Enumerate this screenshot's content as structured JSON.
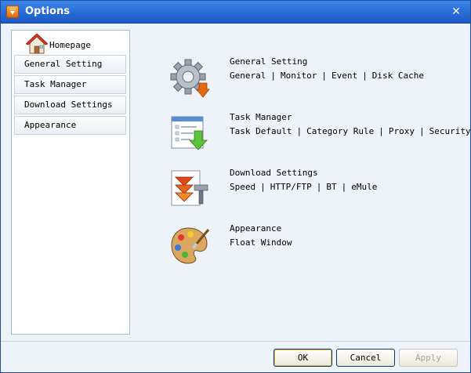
{
  "window": {
    "title": "Options"
  },
  "sidebar": {
    "home_label": "Homepage",
    "items": [
      {
        "label": "General Setting"
      },
      {
        "label": "Task Manager"
      },
      {
        "label": "Download Settings"
      },
      {
        "label": "Appearance"
      }
    ]
  },
  "sections": [
    {
      "title": "General Setting",
      "icon": "gear-icon",
      "links": [
        "General",
        "Monitor",
        "Event",
        "Disk Cache"
      ]
    },
    {
      "title": "Task Manager",
      "icon": "task-list-icon",
      "links": [
        "Task Default",
        "Category Rule",
        "Proxy",
        "Security"
      ]
    },
    {
      "title": "Download Settings",
      "icon": "download-arrow-icon",
      "links": [
        "Speed",
        "HTTP/FTP",
        "BT",
        "eMule"
      ]
    },
    {
      "title": "Appearance",
      "icon": "palette-icon",
      "links": [
        "Float Window"
      ]
    }
  ],
  "buttons": {
    "ok": "OK",
    "cancel": "Cancel",
    "apply": "Apply"
  },
  "colors": {
    "titlebar": "#2a6fd9",
    "background": "#eef2f9",
    "accent": "#e46810"
  }
}
